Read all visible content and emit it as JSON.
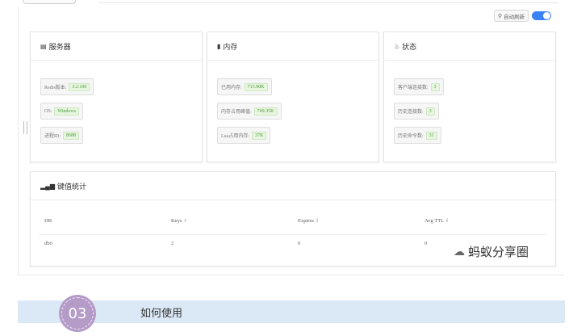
{
  "toolbar": {
    "auto_refresh_label": "自动刷新",
    "refresh_icon": "search-icon",
    "toggle_on": true,
    "accent": "#3b82f6"
  },
  "server": {
    "title": "服务器",
    "icon": "server-icon",
    "items": [
      {
        "label": "Redis版本:",
        "value": "3.2.100"
      },
      {
        "label": "OS:",
        "value": "Windows"
      },
      {
        "label": "进程ID:",
        "value": "8688"
      }
    ]
  },
  "memory": {
    "title": "内存",
    "icon": "memory-icon",
    "items": [
      {
        "label": "已用内存:",
        "value": "713.90K"
      },
      {
        "label": "内存占用峰值:",
        "value": "749.35K"
      },
      {
        "label": "Lua占用内存:",
        "value": "37K"
      }
    ]
  },
  "status": {
    "title": "状态",
    "icon": "status-icon",
    "items": [
      {
        "label": "客户端连接数:",
        "value": "3"
      },
      {
        "label": "历史连接数:",
        "value": "3"
      },
      {
        "label": "历史命令数:",
        "value": "31"
      }
    ]
  },
  "keys": {
    "title": "键值统计",
    "icon": "bar-chart-icon",
    "columns": [
      "DB",
      "Keys",
      "Expires",
      "Avg TTL"
    ],
    "rows": [
      {
        "db": "db0",
        "keys": "2",
        "expires": "0",
        "avg_ttl": "0"
      }
    ]
  },
  "watermark": {
    "text": "蚂蚁分享圈",
    "icon": "wechat-icon"
  },
  "section": {
    "number": "03",
    "title": "如何使用",
    "banner_color": "#dbe9f6",
    "badge_color": "#b59bc8"
  }
}
